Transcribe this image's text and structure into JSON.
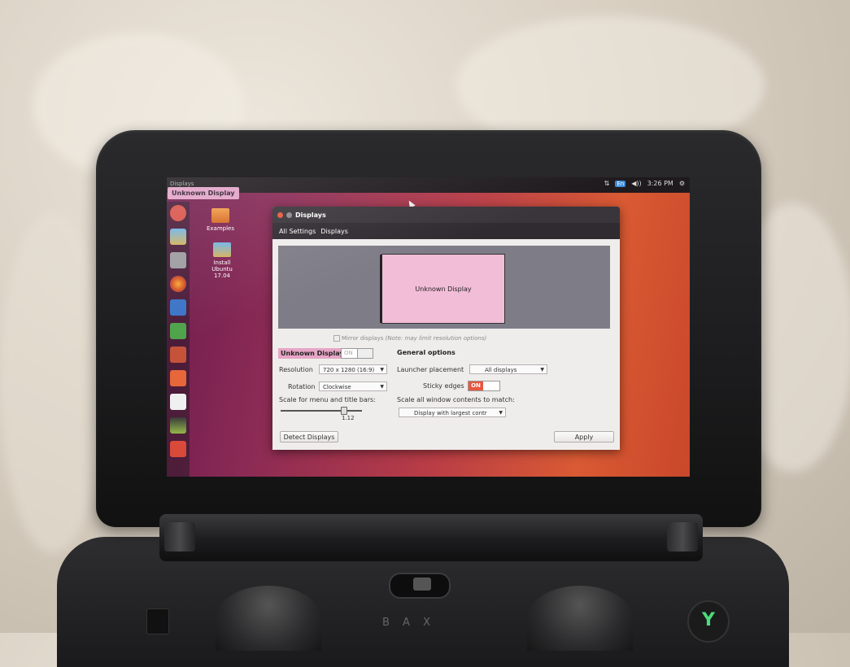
{
  "panel": {
    "app_title": "Displays",
    "time": "3:26 PM",
    "keyboard": "En"
  },
  "launcher_tooltip": "Unknown Display",
  "desktop": {
    "examples": "Examples",
    "install": [
      "Install",
      "Ubuntu",
      "17.04"
    ]
  },
  "window": {
    "title": "Displays",
    "breadcrumb_all": "All Settings",
    "breadcrumb_current": "Displays",
    "monitor_label": "Unknown Display",
    "mirror_label": "Mirror displays",
    "mirror_note": "(Note: may limit resolution options)",
    "display_name": "Unknown Display",
    "display_toggle": "ON",
    "resolution_label": "Resolution",
    "resolution_value": "720 x 1280 (16:9)",
    "rotation_label": "Rotation",
    "rotation_value": "Clockwise",
    "scale_label": "Scale for menu and title bars:",
    "scale_value": "1.12",
    "general_heading": "General options",
    "launcher_label": "Launcher placement",
    "launcher_value": "All displays",
    "sticky_label": "Sticky edges",
    "sticky_value": "ON",
    "scale_all_label": "Scale all window contents to match:",
    "scale_all_value": "Display with largest contr",
    "detect_button": "Detect Displays",
    "apply_button": "Apply"
  },
  "controller": {
    "y_button": "Y",
    "abc": "B A X"
  }
}
